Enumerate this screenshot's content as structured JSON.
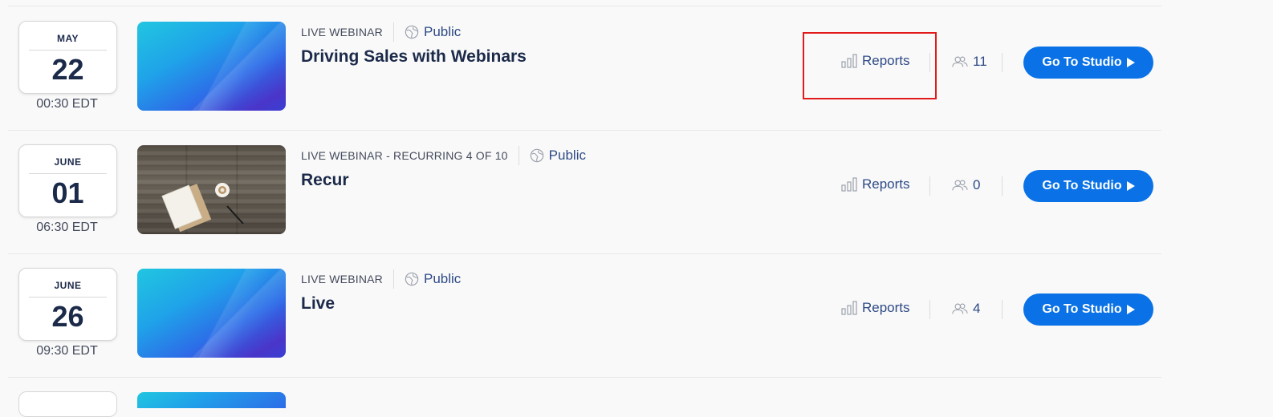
{
  "webinars": [
    {
      "month": "MAY",
      "day": "22",
      "time": "00:30 EDT",
      "kind": "LIVE WEBINAR",
      "visibility": "Public",
      "title": "Driving Sales with Webinars",
      "reports_label": "Reports",
      "attendees": "11",
      "studio_label": "Go To Studio",
      "thumbnail": "blue-gradient"
    },
    {
      "month": "JUNE",
      "day": "01",
      "time": "06:30 EDT",
      "kind": "LIVE WEBINAR - RECURRING 4 OF 10",
      "visibility": "Public",
      "title": "Recur",
      "reports_label": "Reports",
      "attendees": "0",
      "studio_label": "Go To Studio",
      "thumbnail": "wood-desk-photo"
    },
    {
      "month": "JUNE",
      "day": "26",
      "time": "09:30 EDT",
      "kind": "LIVE WEBINAR",
      "visibility": "Public",
      "title": "Live",
      "reports_label": "Reports",
      "attendees": "4",
      "studio_label": "Go To Studio",
      "thumbnail": "blue-gradient"
    }
  ],
  "icons": {
    "visibility": "globe-icon",
    "reports": "bar-chart-icon",
    "attendees": "people-icon",
    "studio": "play-icon"
  },
  "colors": {
    "primary_button": "#0a72e6",
    "link_text": "#2d4a86",
    "title_text": "#1c2a4a",
    "highlight": "#e11b1b"
  }
}
